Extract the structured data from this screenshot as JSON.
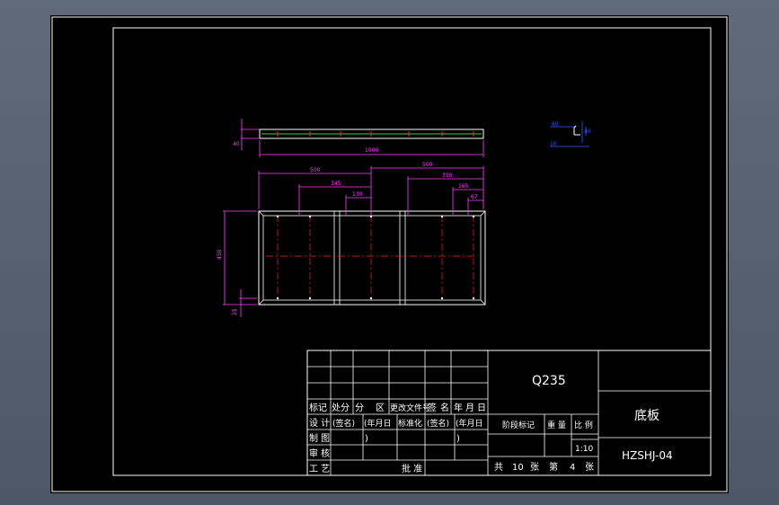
{
  "colors": {
    "background": "#000000",
    "frame": "#ffffff",
    "dimension": "#ff40ff",
    "centerline": "#ff2020",
    "section": "#3b5bff",
    "part_line": "#ffff66"
  },
  "top_view": {
    "thickness_label": "40",
    "length_label": "1000"
  },
  "section_view": {
    "labels": [
      "60",
      "40",
      "10"
    ]
  },
  "plan_view": {
    "dim_left_half": "500",
    "dim_right_half": "500",
    "dim_345": "345",
    "dim_130": "130",
    "dim_350": "350",
    "dim_165": "165",
    "dim_67": "67",
    "dim_height": "450",
    "dim_bottom": "25"
  },
  "title_block": {
    "material": "Q235",
    "part_name": "底板",
    "drawing_number": "HZSHJ-04",
    "header_row": [
      "标记",
      "处分",
      "分",
      "区",
      "更改文件号",
      "签",
      "名",
      "年",
      "月",
      "日"
    ],
    "design_row": [
      "设 计",
      "(签名)",
      "(年月日",
      "标准化",
      "(签名)",
      "(年月日"
    ],
    "drawing_row": [
      "制 图",
      ")",
      ")"
    ],
    "check_row": [
      "审 核"
    ],
    "process_row": [
      "工 艺",
      "批 准"
    ],
    "stage_label": "阶段标记",
    "weight_label": "重 量",
    "scale_label": "比 例",
    "scale_value": "1:10",
    "sheet_info": [
      "共",
      "10",
      "张",
      "第",
      "4",
      "张"
    ]
  }
}
